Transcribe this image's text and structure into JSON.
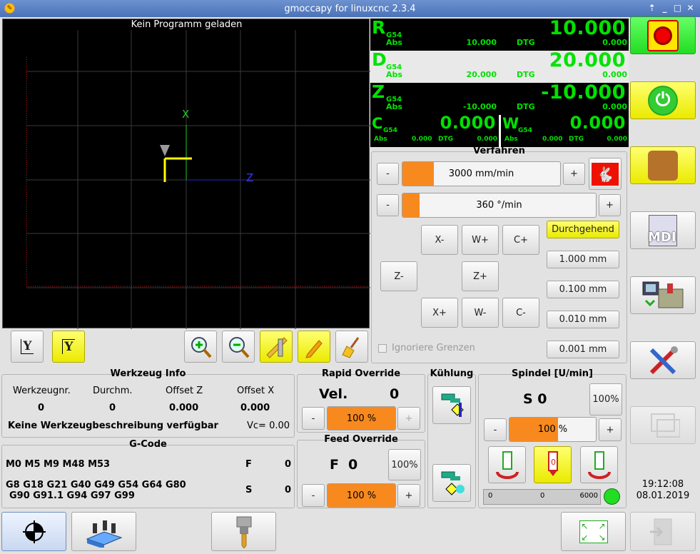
{
  "window": {
    "title": "gmoccapy for linuxcnc  2.3.4"
  },
  "preview": {
    "message": "Kein Programm geladen",
    "axis_x": "X",
    "axis_z": "Z"
  },
  "dro": {
    "rows": [
      {
        "axis": "R",
        "coord": "G54",
        "value": "10.000",
        "abs_label": "Abs",
        "abs": "10.000",
        "dtg_label": "DTG",
        "dtg": "0.000"
      },
      {
        "axis": "D",
        "coord": "G54",
        "value": "20.000",
        "abs_label": "Abs",
        "abs": "20.000",
        "dtg_label": "DTG",
        "dtg": "0.000"
      },
      {
        "axis": "Z",
        "coord": "G54",
        "value": "-10.000",
        "abs_label": "Abs",
        "abs": "-10.000",
        "dtg_label": "DTG",
        "dtg": "0.000"
      }
    ],
    "c": {
      "axis": "C",
      "coord": "G54",
      "value": "0.000",
      "abs_label": "Abs",
      "abs": "0.000",
      "dtg_label": "DTG",
      "dtg": "0.000"
    },
    "w": {
      "axis": "W",
      "coord": "G54",
      "value": "0.000",
      "abs_label": "Abs",
      "abs": "0.000",
      "dtg_label": "DTG",
      "dtg": "0.000"
    }
  },
  "jog": {
    "title": "Verfahren",
    "minus": "-",
    "plus": "+",
    "linear_speed": "3000 mm/min",
    "linear_fill_pct": 20,
    "angular_speed": "360 °/min",
    "angular_fill_pct": 9,
    "buttons": {
      "xm": "X-",
      "wp": "W+",
      "cp": "C+",
      "zm": "Z-",
      "zp": "Z+",
      "xp": "X+",
      "wm": "W-",
      "cm": "C-"
    },
    "continuous": "Durchgehend",
    "increments": [
      "1.000 mm",
      "0.100 mm",
      "0.010 mm",
      "0.001 mm"
    ],
    "ignore_limits": "Ignoriere Grenzen"
  },
  "tool": {
    "title": "Werkzeug Info",
    "headers": [
      "Werkzeugnr.",
      "Durchm.",
      "Offset Z",
      "Offset X"
    ],
    "values": [
      "0",
      "0",
      "0.000",
      "0.000"
    ],
    "description": "Keine Werkzeugbeschreibung verfügbar",
    "vc": "Vc= 0.00"
  },
  "gcode": {
    "title": "G-Code",
    "mcodes": "M0 M5 M9 M48 M53",
    "f_label": "F",
    "f_value": "0",
    "gcodes_line1": "G8 G18 G21 G40 G49 G54 G64 G80",
    "gcodes_line2": "G90 G91.1 G94 G97 G99",
    "s_label": "S",
    "s_value": "0"
  },
  "rapid": {
    "title": "Rapid Override",
    "vel_label": "Vel.",
    "vel_value": "0",
    "pct": "100 %",
    "fill_pct": 100,
    "minus": "-",
    "plus": "+"
  },
  "feed": {
    "title": "Feed Override",
    "f_label": "F",
    "f_value": "0",
    "reset": "100%",
    "pct": "100 %",
    "fill_pct": 100,
    "minus": "-",
    "plus": "+"
  },
  "cool": {
    "title": "Kühlung"
  },
  "spindle": {
    "title": "Spindel [U/min]",
    "s_label": "S 0",
    "reset": "100%",
    "pct": "100 %",
    "fill_pct": 56,
    "minus": "-",
    "plus": "+",
    "bar_left": "0",
    "bar_mid": "0",
    "bar_right": "6000"
  },
  "clock": {
    "time": "19:12:08",
    "date": "08.01.2019"
  },
  "side": {
    "mdi_label": "MDI"
  },
  "colors": {
    "dro_green": "#00e200",
    "accent_orange": "#f7891f",
    "active_yellow": "#ffff33",
    "estop_green": "#33ee33"
  }
}
